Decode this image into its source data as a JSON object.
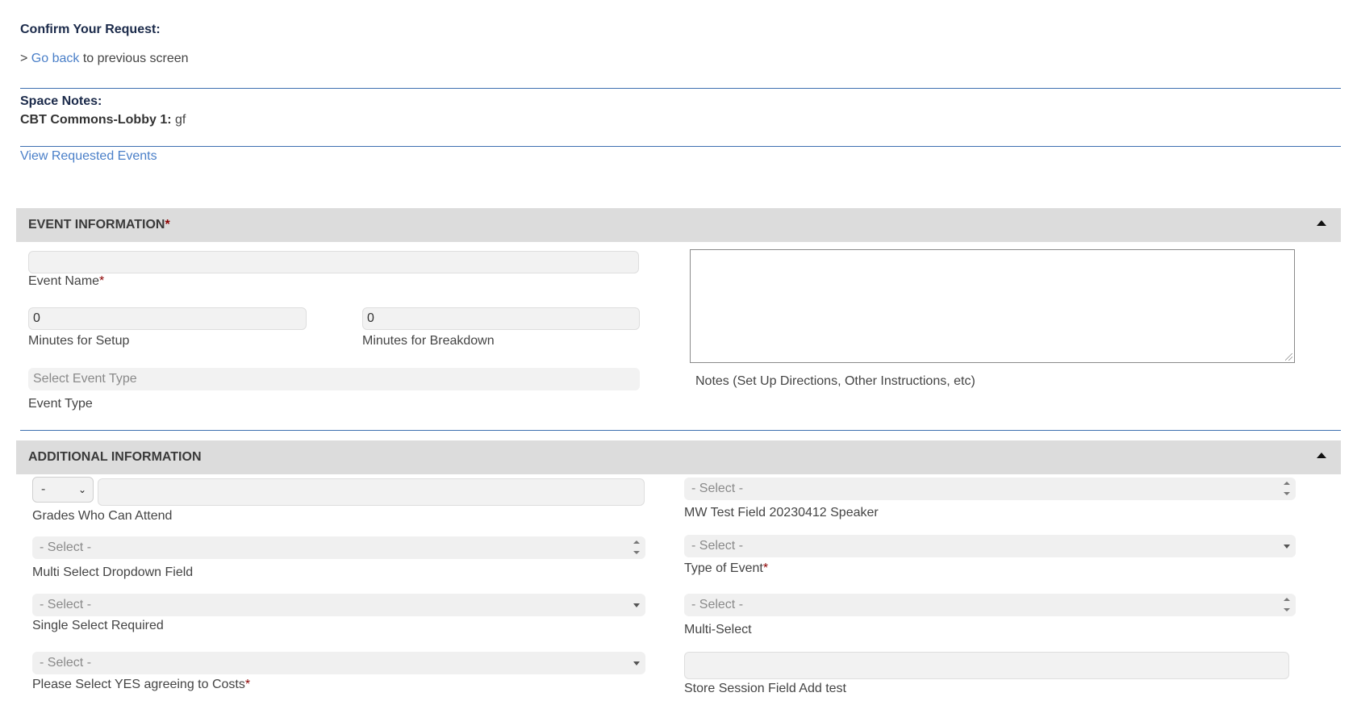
{
  "header": {
    "title": "Confirm Your Request:",
    "goback_prefix": "> ",
    "goback_link": "Go back",
    "goback_suffix": " to previous screen"
  },
  "space_notes": {
    "label": "Space Notes:",
    "space_name": "CBT Commons-Lobby 1:",
    "space_note": " gf",
    "view_link": "View Requested Events"
  },
  "event_info": {
    "title": "EVENT INFORMATION",
    "required_mark": "*",
    "event_name_value": "",
    "event_name_label": "Event Name",
    "setup_value": "0",
    "setup_label": "Minutes for Setup",
    "breakdown_value": "0",
    "breakdown_label": "Minutes for Breakdown",
    "event_type_placeholder": "Select Event Type",
    "event_type_label": "Event Type",
    "notes_label": "Notes (Set Up Directions, Other Instructions, etc)"
  },
  "additional_info": {
    "title": "ADDITIONAL INFORMATION",
    "grades_select_value": "-",
    "grades_label": "Grades Who Can Attend",
    "multi_dropdown_value": "- Select -",
    "multi_dropdown_label": "Multi Select Dropdown Field",
    "single_required_value": "- Select -",
    "single_required_label": "Single Select Required",
    "costs_value": "- Select -",
    "costs_label": "Please Select YES agreeing to Costs",
    "speaker_value": "- Select -",
    "speaker_label": "MW Test Field 20230412 Speaker",
    "type_of_event_value": "- Select -",
    "type_of_event_label": "Type of Event",
    "multi_select_value": "- Select -",
    "multi_select_label": "Multi-Select",
    "store_session_label": "Store Session Field Add test"
  },
  "colors": {
    "link": "#4a7fc8",
    "divider": "#3d6fb0",
    "section_bar": "#dcdcdc",
    "required": "#8b0000"
  }
}
